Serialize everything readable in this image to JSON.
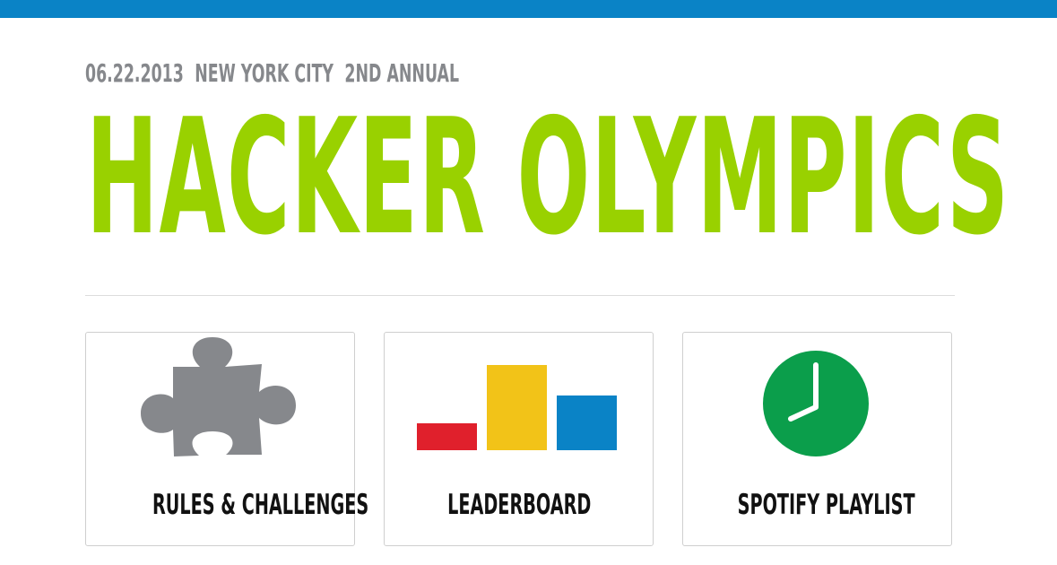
{
  "header": {
    "date": "06.22.2013",
    "location": "NEW YORK CITY",
    "edition": "2ND ANNUAL",
    "title": "HACKER OLYMPICS"
  },
  "cards": [
    {
      "label": "RULES & CHALLENGES",
      "icon": "puzzle-piece-icon"
    },
    {
      "label": "LEADERBOARD",
      "icon": "leaderboard-bars-icon"
    },
    {
      "label": "SPOTIFY PLAYLIST",
      "icon": "clock-icon"
    }
  ],
  "colors": {
    "top_bar": "#0a83c6",
    "title": "#99d100",
    "subhead": "#86888c",
    "puzzle": "#86888c",
    "bar_red": "#e0202c",
    "bar_yellow": "#f2c318",
    "bar_blue": "#0a83c6",
    "clock": "#0b9e4b"
  }
}
